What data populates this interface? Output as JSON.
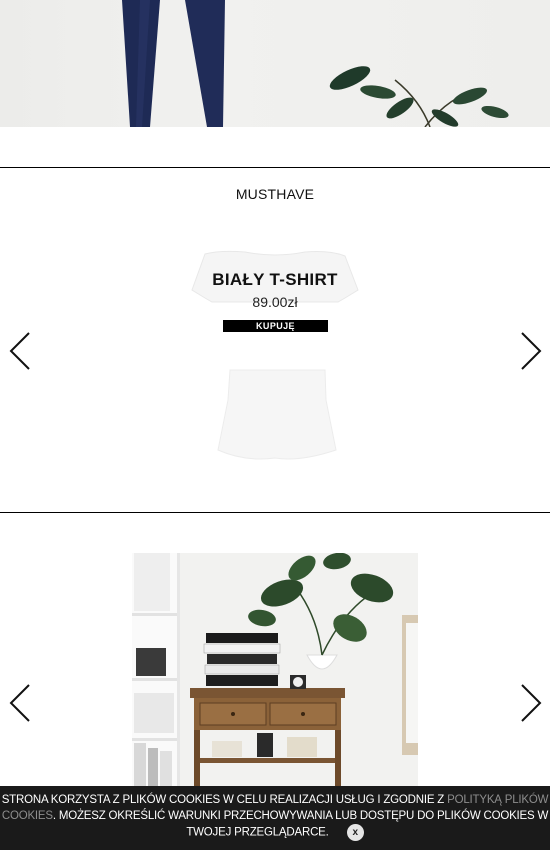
{
  "hero": {
    "icon": "hero-photo"
  },
  "musthave": {
    "title": "MUSTHAVE",
    "product": {
      "name": "BIAŁY T-SHIRT",
      "price": "89.00zł",
      "buy_label": "KUPUJĘ"
    },
    "prev_icon": "chevron-left-icon",
    "next_icon": "chevron-right-icon"
  },
  "gallery": {
    "prev_icon": "chevron-left-icon",
    "next_icon": "chevron-right-icon"
  },
  "cookie_bar": {
    "text_before": "STRONA KORZYSTA Z PLIKÓW COOKIES W CELU REALIZACJI USŁUG I ZGODNIE Z ",
    "link_text": "POLITYKĄ PLIKÓW COOKIES",
    "text_after": ". MOŻESZ OKREŚLIĆ WARUNKI PRZECHOWYWANIA LUB DOSTĘPU DO PLIKÓW COOKIES W TWOJEJ PRZEGLĄDARCE.",
    "close_label": "x"
  }
}
